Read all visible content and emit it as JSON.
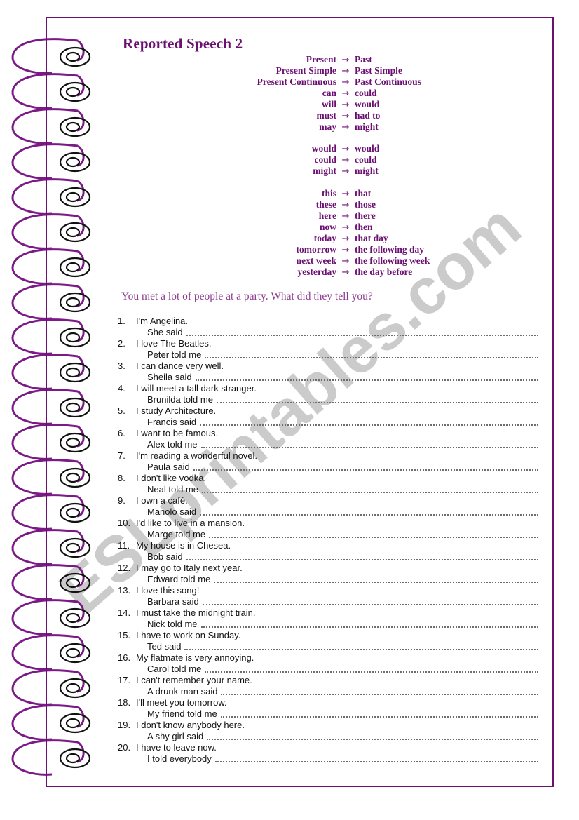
{
  "worksheet": {
    "title": "Reported Speech 2",
    "instruction": "You met a lot of people at a party. What did they tell you?",
    "watermark": "ESLprintables.com",
    "accent_color": "#6B1072",
    "instruction_color": "#8E3C8E",
    "arrow_glyph": "→"
  },
  "rules": {
    "group1": [
      {
        "from": "Present",
        "to": "Past"
      },
      {
        "from": "Present Simple",
        "to": "Past Simple"
      },
      {
        "from": "Present Continuous",
        "to": "Past Continuous"
      },
      {
        "from": "can",
        "to": "could"
      },
      {
        "from": "will",
        "to": "would"
      },
      {
        "from": "must",
        "to": "had to"
      },
      {
        "from": "may",
        "to": "might"
      }
    ],
    "group2": [
      {
        "from": "would",
        "to": "would"
      },
      {
        "from": "could",
        "to": "could"
      },
      {
        "from": "might",
        "to": "might"
      }
    ],
    "group3": [
      {
        "from": "this",
        "to": "that"
      },
      {
        "from": "these",
        "to": "those"
      },
      {
        "from": "here",
        "to": "there"
      },
      {
        "from": "now",
        "to": "then"
      },
      {
        "from": "today",
        "to": "that day"
      },
      {
        "from": "tomorrow",
        "to": "the following day"
      },
      {
        "from": "next week",
        "to": "the following week"
      },
      {
        "from": "yesterday",
        "to": "the day before"
      }
    ]
  },
  "exercise": [
    {
      "num": "1.",
      "quote": "I'm  Angelina.",
      "cue": "She said"
    },
    {
      "num": "2.",
      "quote": "I love The Beatles.",
      "cue": "Peter told me"
    },
    {
      "num": "3.",
      "quote": "I can dance very well.",
      "cue": "Sheila said"
    },
    {
      "num": "4.",
      "quote": "I will meet a tall dark stranger.",
      "cue": "Brunilda told me"
    },
    {
      "num": "5.",
      "quote": "I study Architecture.",
      "cue": "Francis said"
    },
    {
      "num": "6.",
      "quote": "I want to be  famous.",
      "cue": "Alex told me"
    },
    {
      "num": "7.",
      "quote": "I'm reading a wonderful novel.",
      "cue": "Paula said"
    },
    {
      "num": "8.",
      "quote": "I don't like vodka.",
      "cue": "Neal told me"
    },
    {
      "num": "9.",
      "quote": "I own a café.",
      "cue": "Manolo said"
    },
    {
      "num": "10.",
      "quote": "I'd like to live in a mansion.",
      "cue": "Marge told me"
    },
    {
      "num": "11.",
      "quote": "My house is in Chesea.",
      "cue": "Bob said"
    },
    {
      "num": "12.",
      "quote": "I may go to Italy next year.",
      "cue": "Edward told me"
    },
    {
      "num": "13.",
      "quote": "I love this song!",
      "cue": "Barbara said"
    },
    {
      "num": "14.",
      "quote": "I must take the midnight train.",
      "cue": "Nick told me"
    },
    {
      "num": "15.",
      "quote": "I have to work on Sunday.",
      "cue": "Ted said"
    },
    {
      "num": "16.",
      "quote": "My flatmate is very annoying.",
      "cue": "Carol told me"
    },
    {
      "num": "17.",
      "quote": "I can't remember your name.",
      "cue": "A drunk man said"
    },
    {
      "num": "18.",
      "quote": "I'll meet you tomorrow.",
      "cue": "My friend  told me"
    },
    {
      "num": "19.",
      "quote": "I don't know anybody here.",
      "cue": "A shy girl  said"
    },
    {
      "num": "20.",
      "quote": "I have to leave now.",
      "cue": "I told everybody"
    }
  ]
}
